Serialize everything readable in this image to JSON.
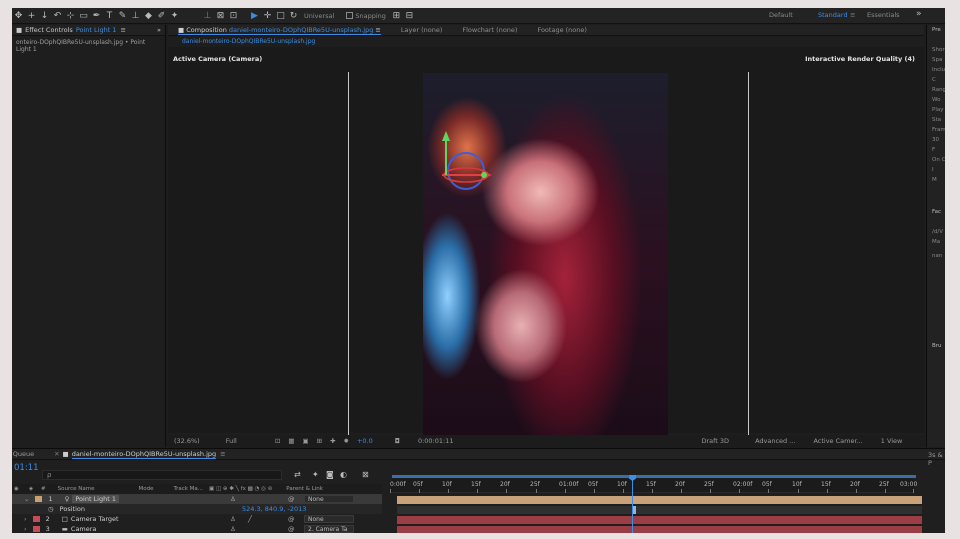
{
  "toolbar": {
    "axis_mode": "Universal",
    "snapping": "Snapping",
    "workspaces": [
      "Default",
      "Standard",
      "Essentials"
    ],
    "active_workspace": "Standard",
    "overflow": "»"
  },
  "effect_controls": {
    "tab_label": "Effect Controls",
    "layer_name": "Point Light 1",
    "subtitle": "onteiro-DOphQIBRe5U-unsplash.jpg • Point Light 1"
  },
  "composition": {
    "tab_label": "Composition",
    "comp_name": "daniel-monteiro-DOphQIBRe5U-unsplash.jpg",
    "other_tabs": [
      "Layer (none)",
      "Flowchart (none)",
      "Footage (none)"
    ],
    "breadcrumb": "daniel-monteiro-DOphQIBRe5U-unsplash.jpg",
    "camera_label": "Active Camera (Camera)",
    "render_quality": "Interactive Render Quality (4)"
  },
  "viewer_bar": {
    "zoom": "(32.6%)",
    "resolution": "Full",
    "exposure": "+0.0",
    "timecode": "0:00:01:11",
    "renderer": "Draft 3D",
    "camera_mode": "Advanced ...",
    "view": "Active Camer...",
    "views": "1 View"
  },
  "right_panel": {
    "items": [
      "Pre",
      "Shor",
      "Spa",
      "Inclu",
      "C",
      "Rang",
      "Wo",
      "Play",
      "Sta",
      "Fram",
      "30",
      "F",
      "On C",
      "I",
      "M",
      "Fac",
      "/d/V",
      "Ma",
      "nan",
      "Bru"
    ]
  },
  "timeline": {
    "left_tab": "r Queue",
    "comp_tab": "daniel-monteiro-DOphQIBRe5U-unsplash.jpg",
    "right_tab": "3s & P",
    "timecode": "01:11",
    "search_placeholder": "ρ",
    "columns": {
      "source_name": "Source Name",
      "mode": "Mode",
      "track_matte": "Track Ma...",
      "parent_link": "Parent & Link"
    },
    "layers": [
      {
        "num": "1",
        "name": "Point Light 1",
        "parent": "None",
        "color": "#c9a16e"
      },
      {
        "num": "",
        "name": "Position",
        "value": "524.3, 840.9, -2013",
        "parent": "",
        "color": ""
      },
      {
        "num": "2",
        "name": "Camera Target",
        "parent": "None",
        "color": "#c84a55"
      },
      {
        "num": "3",
        "name": "Camera",
        "parent": "2. Camera Ta",
        "color": "#c84a55"
      }
    ],
    "ruler": [
      "0:00f",
      "05f",
      "10f",
      "15f",
      "20f",
      "25f",
      "01:00f",
      "05f",
      "10f",
      "15f",
      "20f",
      "25f",
      "02:00f",
      "05f",
      "10f",
      "15f",
      "20f",
      "25f",
      "03:00"
    ]
  }
}
